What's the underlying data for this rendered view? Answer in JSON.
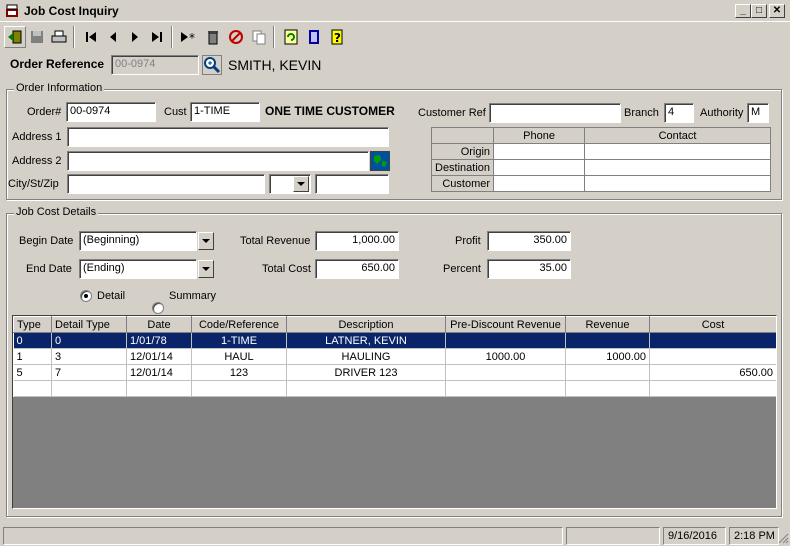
{
  "window": {
    "title": "Job Cost Inquiry",
    "minimize": "_",
    "maximize": "□",
    "close": "✕"
  },
  "toolbar": {
    "buttons": [
      "exit-icon",
      "save-icon",
      "print-icon",
      "first-record-icon",
      "previous-record-icon",
      "next-record-icon",
      "last-record-icon",
      "new-record-icon",
      "delete-icon",
      "cancel-icon",
      "copy-icon",
      "refresh-icon",
      "report-icon",
      "help-icon"
    ]
  },
  "order_ref": {
    "label": "Order Reference",
    "value": "00-0974",
    "customer_name": "SMITH, KEVIN"
  },
  "order_info": {
    "group_title": "Order Information",
    "order_label": "Order#",
    "order_value": "00-0974",
    "cust_label": "Cust",
    "cust_value": "1-TIME",
    "cust_name": "ONE TIME CUSTOMER",
    "customer_ref_label": "Customer Ref",
    "customer_ref_value": "",
    "branch_label": "Branch",
    "branch_value": "4",
    "authority_label": "Authority",
    "authority_value": "M",
    "address1_label": "Address 1",
    "address1_value": "",
    "address2_label": "Address 2",
    "address2_value": "",
    "city_label": "City/St/Zip",
    "city_value": "",
    "state_value": "",
    "zip_value": "",
    "contacts": {
      "headers": [
        "",
        "Phone",
        "Contact"
      ],
      "rows": [
        {
          "label": "Origin",
          "phone": "",
          "contact": ""
        },
        {
          "label": "Destination",
          "phone": "",
          "contact": ""
        },
        {
          "label": "Customer",
          "phone": "",
          "contact": ""
        }
      ]
    }
  },
  "job_cost": {
    "group_title": "Job Cost Details",
    "begin_date_label": "Begin Date",
    "begin_date_value": "(Beginning)",
    "end_date_label": "End Date",
    "end_date_value": "(Ending)",
    "total_revenue_label": "Total Revenue",
    "total_revenue_value": "1,000.00",
    "total_cost_label": "Total Cost",
    "total_cost_value": "650.00",
    "profit_label": "Profit",
    "profit_value": "350.00",
    "percent_label": "Percent",
    "percent_value": "35.00",
    "detail_label": "Detail",
    "summary_label": "Summary",
    "selected_view": "Detail"
  },
  "grid": {
    "headers": [
      "Type",
      "Detail Type",
      "Date",
      "Code/Reference",
      "Description",
      "Pre-Discount Revenue",
      "Revenue",
      "Cost"
    ],
    "rows": [
      {
        "type": "0",
        "detail_type": "0",
        "date": "1/01/78",
        "code": "1-TIME",
        "description": "LATNER, KEVIN",
        "pre_discount": "",
        "revenue": "",
        "cost": ""
      },
      {
        "type": "1",
        "detail_type": "3",
        "date": "12/01/14",
        "code": "HAUL",
        "description": "HAULING",
        "pre_discount": "1000.00",
        "revenue": "1000.00",
        "cost": ""
      },
      {
        "type": "5",
        "detail_type": "7",
        "date": "12/01/14",
        "code": "123",
        "description": "DRIVER 123",
        "pre_discount": "",
        "revenue": "",
        "cost": "650.00"
      }
    ]
  },
  "status": {
    "date": "9/16/2016",
    "time": "2:18 PM"
  },
  "colors": {
    "selection": "#0a246a",
    "face": "#d4d0c8"
  }
}
